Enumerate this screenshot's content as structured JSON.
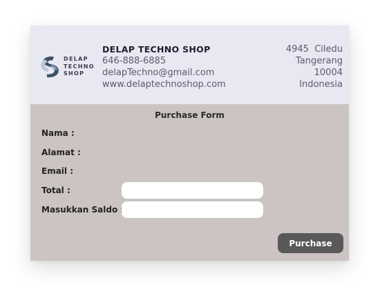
{
  "header": {
    "logo_lines": [
      "DELAP",
      "TECHNO",
      "SHOP"
    ],
    "company_name": "DELAP TECHNO SHOP",
    "phone": "646-888-6885",
    "email": "delapTechno@gmail.com",
    "website": "www.delaptechnoshop.com",
    "address": {
      "street": "4945  Ciledu",
      "city": "Tangerang",
      "postal_code": "10004",
      "country": "Indonesia"
    }
  },
  "form": {
    "title": "Purchase Form",
    "labels": {
      "nama": "Nama :",
      "alamat": "Alamat :",
      "email": "Email :",
      "total": "Total :",
      "saldo": "Masukkan Saldo :"
    },
    "inputs": {
      "total_value": "",
      "saldo_value": ""
    },
    "purchase_button": "Purchase"
  },
  "colors": {
    "header_bg": "#e8e8f3",
    "form_bg": "#cbc4c2",
    "button_bg": "#595959",
    "logo_dark": "#3f5266",
    "logo_light": "#b9c7d6"
  }
}
